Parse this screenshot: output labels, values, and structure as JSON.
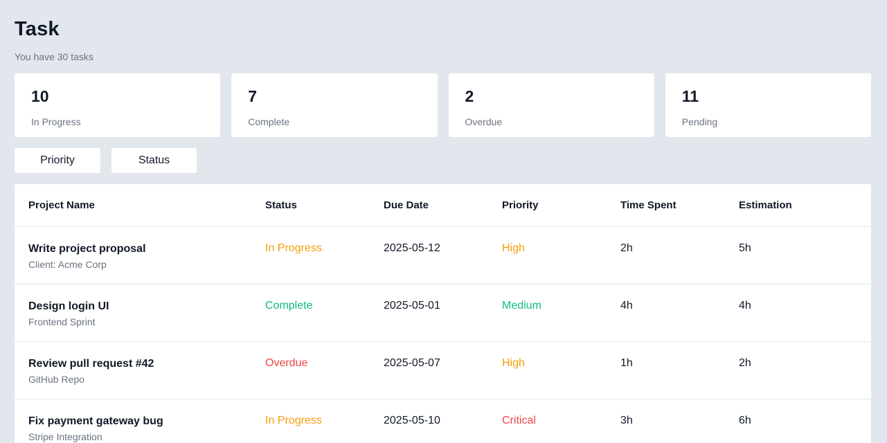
{
  "header": {
    "title": "Task",
    "subtitle": "You have 30 tasks"
  },
  "summary": [
    {
      "count": "10",
      "label": "In Progress"
    },
    {
      "count": "7",
      "label": "Complete"
    },
    {
      "count": "2",
      "label": "Overdue"
    },
    {
      "count": "11",
      "label": "Pending"
    }
  ],
  "filters": {
    "priority_label": "Priority",
    "status_label": "Status"
  },
  "table": {
    "columns": [
      "Project Name",
      "Status",
      "Due Date",
      "Priority",
      "Time Spent",
      "Estimation"
    ],
    "rows": [
      {
        "name": "Write project proposal",
        "sub": "Client: Acme Corp",
        "status": "In Progress",
        "due": "2025-05-12",
        "priority": "High",
        "time": "2h",
        "estimate": "5h"
      },
      {
        "name": "Design login UI",
        "sub": "Frontend Sprint",
        "status": "Complete",
        "due": "2025-05-01",
        "priority": "Medium",
        "time": "4h",
        "estimate": "4h"
      },
      {
        "name": "Review pull request #42",
        "sub": "GitHub Repo",
        "status": "Overdue",
        "due": "2025-05-07",
        "priority": "High",
        "time": "1h",
        "estimate": "2h"
      },
      {
        "name": "Fix payment gateway bug",
        "sub": "Stripe Integration",
        "status": "In Progress",
        "due": "2025-05-10",
        "priority": "Critical",
        "time": "3h",
        "estimate": "6h"
      }
    ]
  },
  "colors": {
    "in_progress": "#f59e0b",
    "complete": "#10b981",
    "overdue": "#ef4444",
    "background": "#e2e6ed"
  }
}
